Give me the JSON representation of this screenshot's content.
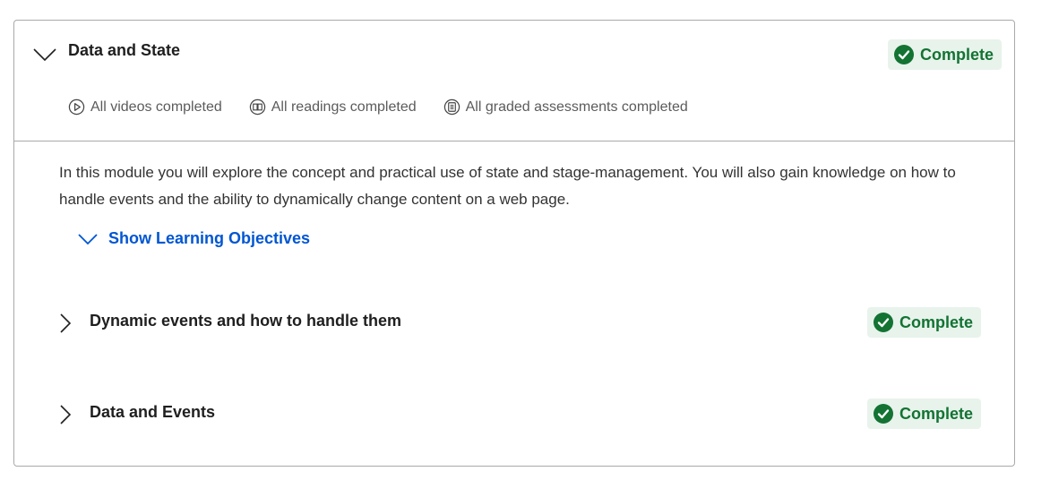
{
  "module": {
    "title": "Data and State",
    "status": "Complete",
    "summary": {
      "videos": "All videos completed",
      "readings": "All readings completed",
      "assessments": "All graded assessments completed"
    },
    "description": "In this module you will explore the concept and practical use of state and stage-management. You will also gain knowledge on how to handle events and the ability to dynamically change content on a web page.",
    "objectives_link": "Show Learning Objectives"
  },
  "lessons": [
    {
      "title": "Dynamic events and how to handle them",
      "status": "Complete"
    },
    {
      "title": "Data and Events",
      "status": "Complete"
    }
  ],
  "colors": {
    "complete_text": "#137333",
    "complete_bg": "#e8f3ec",
    "link": "#0056d2",
    "border": "#a9a9a9"
  },
  "icons": {
    "expand": "chevron-down-icon",
    "collapse": "chevron-right-icon",
    "check": "check-circle-icon",
    "video": "play-circle-icon",
    "reading": "book-icon",
    "assessment": "list-icon"
  }
}
